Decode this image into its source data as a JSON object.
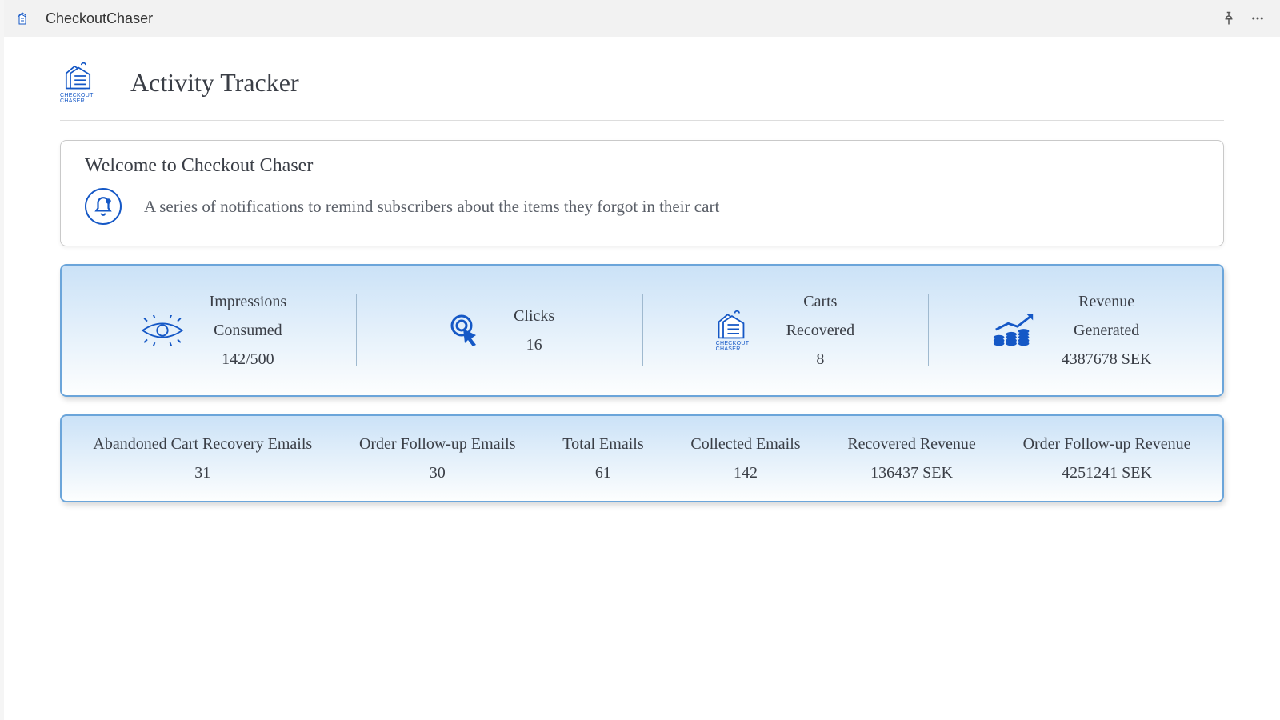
{
  "topbar": {
    "app_title": "CheckoutChaser"
  },
  "header": {
    "logo_caption": "CHECKOUT CHASER",
    "page_title": "Activity Tracker"
  },
  "welcome": {
    "heading": "Welcome to Checkout Chaser",
    "subtext": "A series of notifications to remind subscribers about the items they forgot in their cart"
  },
  "stats": {
    "impressions": {
      "label_line1": "Impressions",
      "label_line2": "Consumed",
      "value": "142/500"
    },
    "clicks": {
      "label": "Clicks",
      "value": "16"
    },
    "carts": {
      "label_line1": "Carts",
      "label_line2": "Recovered",
      "value": "8"
    },
    "revenue": {
      "label_line1": "Revenue",
      "label_line2": "Generated",
      "value": "4387678 SEK"
    }
  },
  "metrics": {
    "abandoned": {
      "label": "Abandoned Cart Recovery Emails",
      "value": "31"
    },
    "followup": {
      "label": "Order Follow-up Emails",
      "value": "30"
    },
    "total": {
      "label": "Total Emails",
      "value": "61"
    },
    "collected": {
      "label": "Collected Emails",
      "value": "142"
    },
    "recovered_rev": {
      "label": "Recovered Revenue",
      "value": "136437 SEK"
    },
    "followup_rev": {
      "label": "Order Follow-up Revenue",
      "value": "4251241 SEK"
    }
  }
}
